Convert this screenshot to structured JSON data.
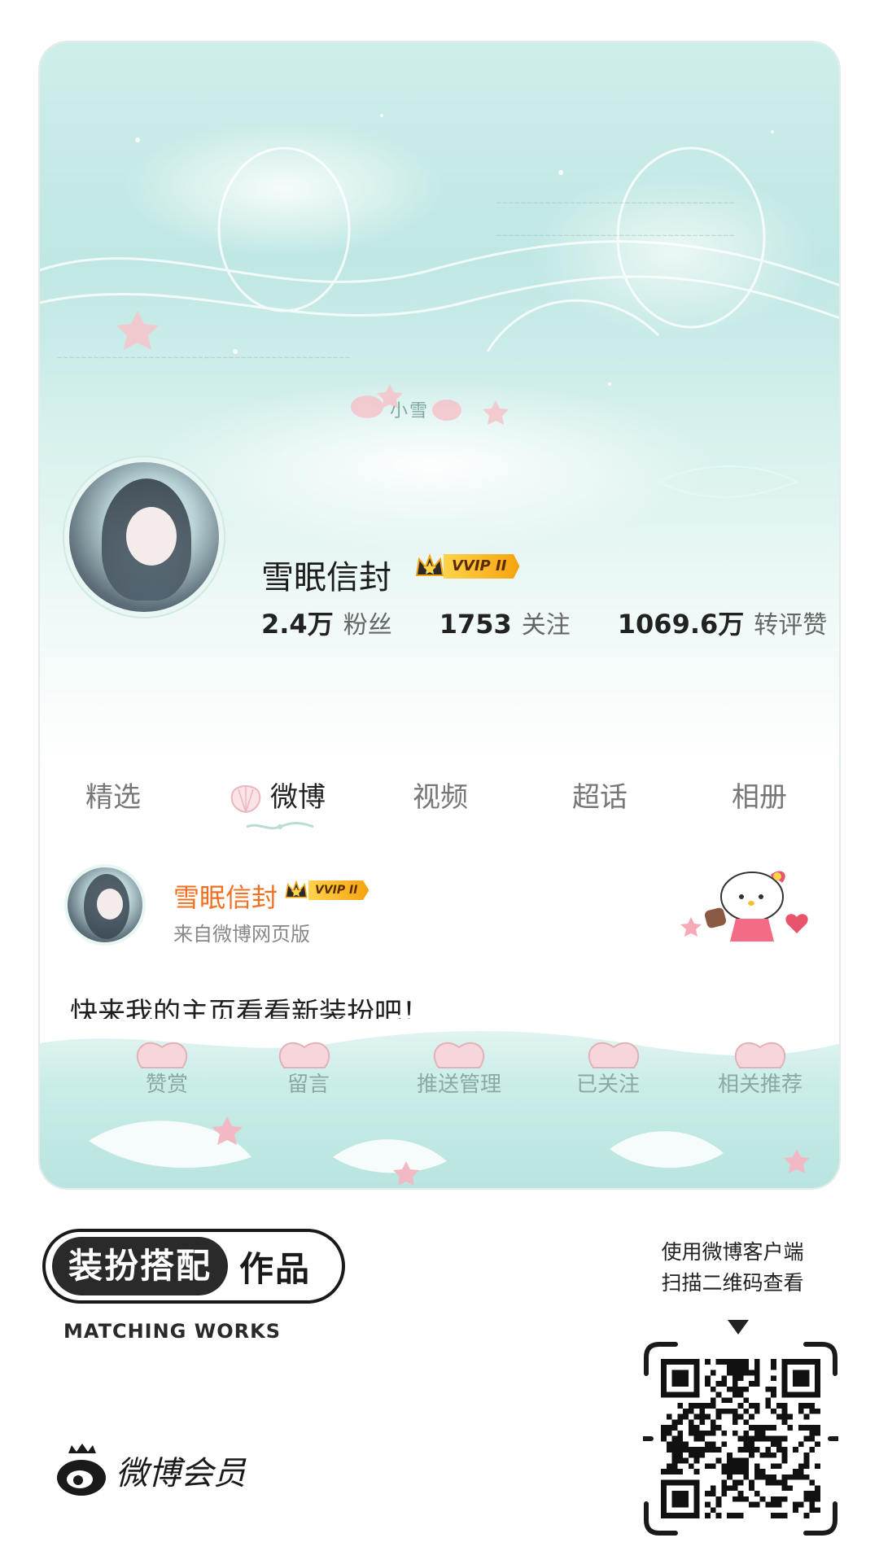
{
  "banner": {
    "signature": "小雪"
  },
  "profile": {
    "name": "雪眠信封",
    "vip_label": "VVIP II",
    "stats": [
      {
        "value": "2.4万",
        "label": "粉丝"
      },
      {
        "value": "1753",
        "label": "关注"
      },
      {
        "value": "1069.6万",
        "label": "转评赞"
      }
    ]
  },
  "tabs": [
    {
      "label": "精选"
    },
    {
      "label": "微博"
    },
    {
      "label": "视频"
    },
    {
      "label": "超话"
    },
    {
      "label": "相册"
    }
  ],
  "post": {
    "author": "雪眠信封",
    "vip_label": "VVIP II",
    "source": "来自微博网页版",
    "text": "快来我的主页看看新装扮吧！"
  },
  "actions": [
    {
      "label": "赞赏"
    },
    {
      "label": "留言"
    },
    {
      "label": "推送管理"
    },
    {
      "label": "已关注"
    },
    {
      "label": "相关推荐"
    }
  ],
  "footer": {
    "badge_dark": "装扮搭配",
    "badge_light": "作品",
    "badge_sub": "MATCHING WORKS",
    "brand": "微博会员",
    "qr_hint_line1": "使用微博客户端",
    "qr_hint_line2": "扫描二维码查看"
  },
  "colors": {
    "accent_orange": "#f07021",
    "vip_gold": "#f5a30f",
    "aqua": "#bfe7e3"
  }
}
